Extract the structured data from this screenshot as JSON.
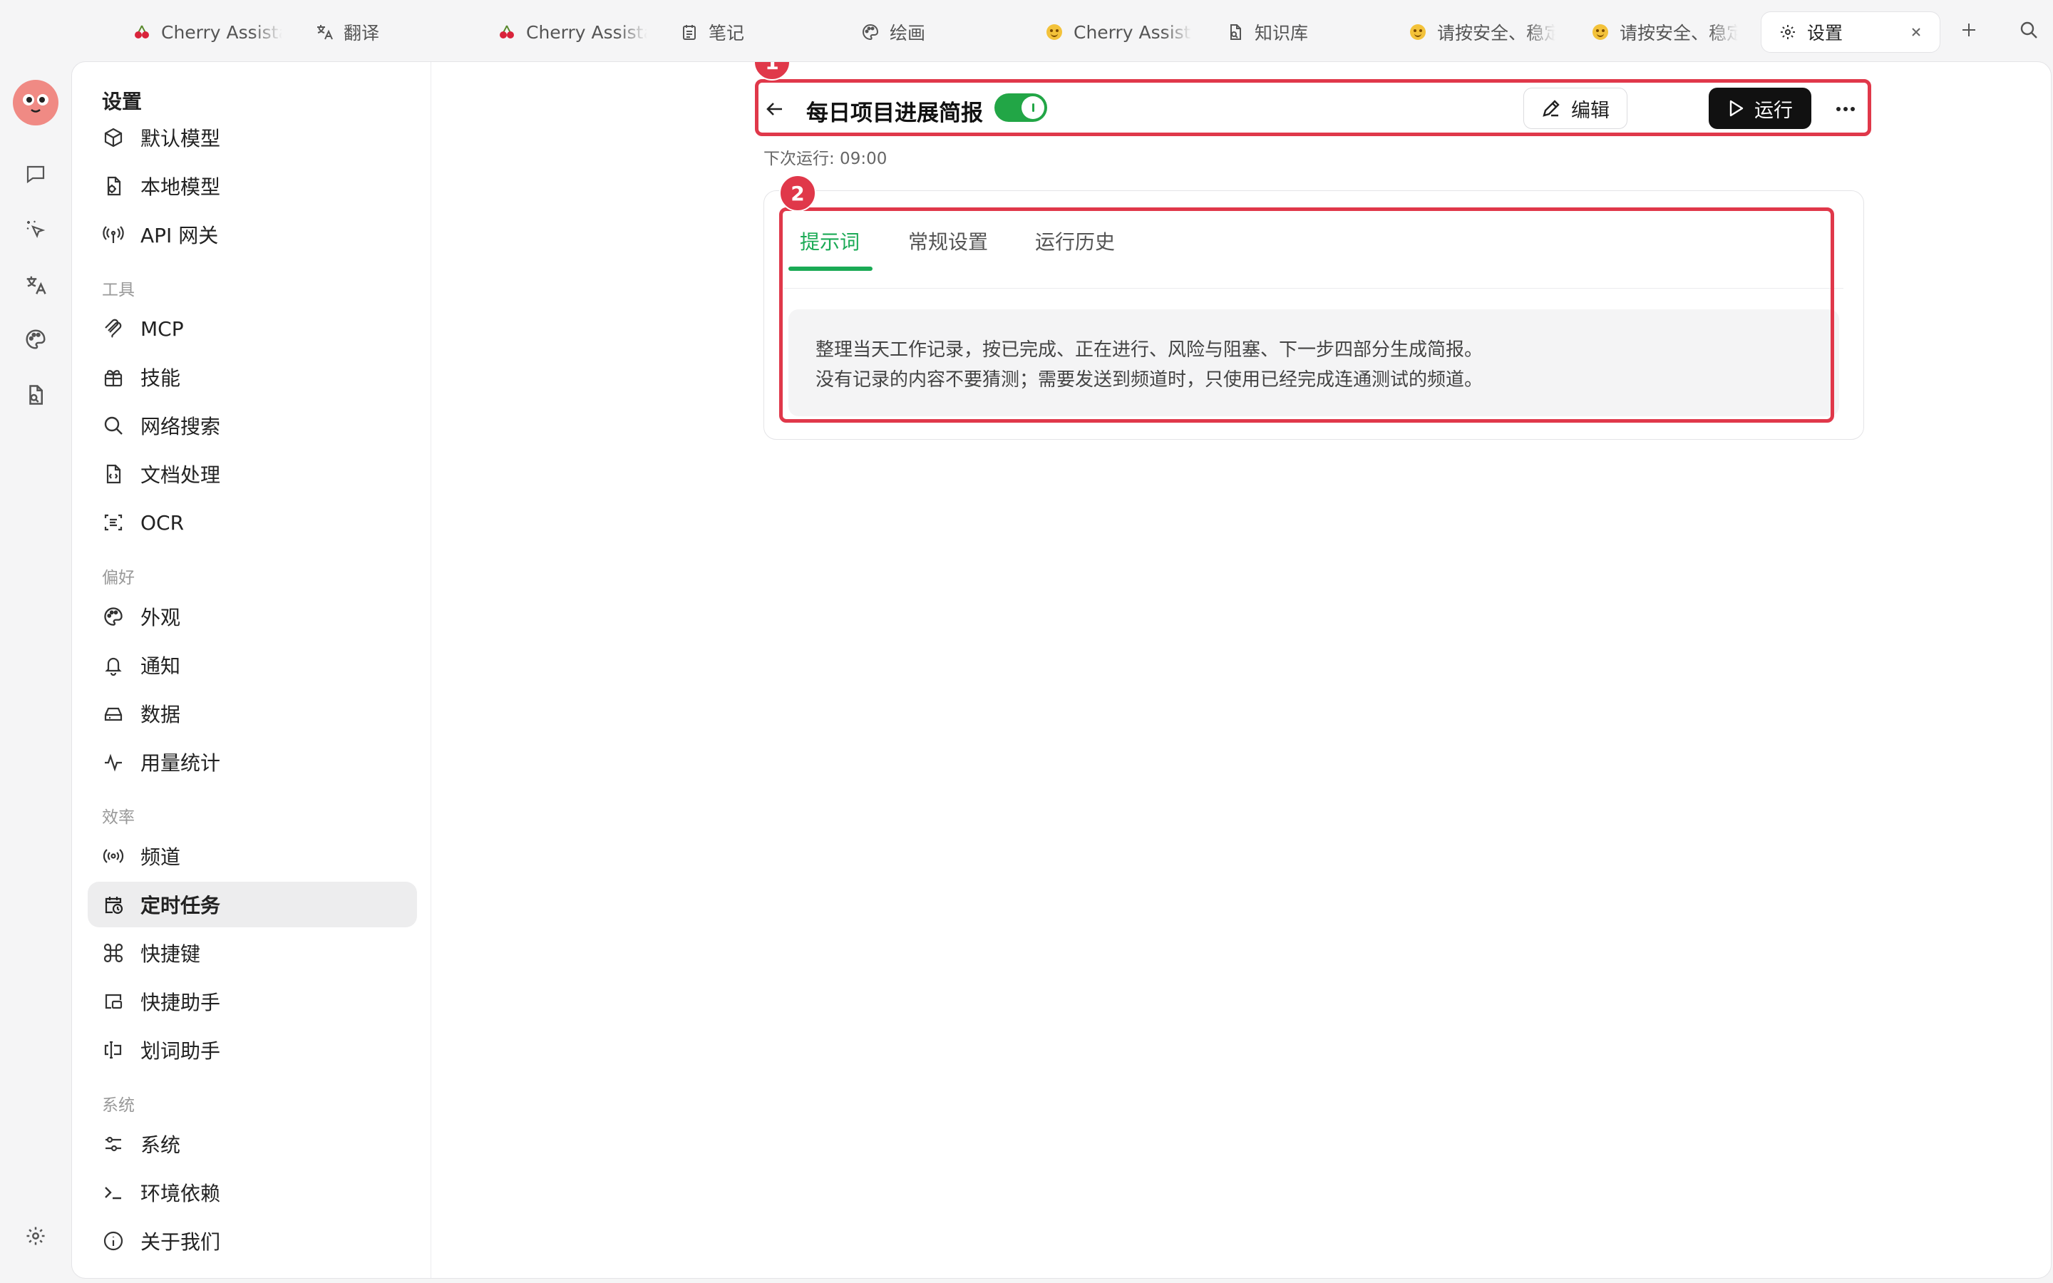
{
  "tabbar": {
    "tabs": [
      {
        "icon": "cherry-icon",
        "label": "Cherry Assistant"
      },
      {
        "icon": "translate-icon",
        "label": "翻译"
      },
      {
        "icon": "cherry-icon",
        "label": "Cherry Assistant"
      },
      {
        "icon": "notes-icon",
        "label": "笔记"
      },
      {
        "icon": "palette-icon",
        "label": "绘画"
      },
      {
        "icon": "smiley-icon",
        "label": "Cherry Assistant"
      },
      {
        "icon": "knowledge-icon",
        "label": "知识库"
      },
      {
        "icon": "smiley-icon",
        "label": "请按安全、稳定"
      },
      {
        "icon": "smiley-icon",
        "label": "请按安全、稳定"
      },
      {
        "icon": "gear-icon",
        "label": "设置"
      }
    ],
    "active_tab": "设置"
  },
  "settings_nav": {
    "title": "设置",
    "top_items": [
      {
        "icon": "cube-icon",
        "label": "默认模型"
      },
      {
        "icon": "local-model-icon",
        "label": "本地模型"
      },
      {
        "icon": "antenna-icon",
        "label": "API 网关"
      }
    ],
    "sections": [
      {
        "title": "工具",
        "items": [
          {
            "icon": "mcp-icon",
            "label": "MCP"
          },
          {
            "icon": "skill-icon",
            "label": "技能"
          },
          {
            "icon": "search-icon",
            "label": "网络搜索"
          },
          {
            "icon": "document-icon",
            "label": "文档处理"
          },
          {
            "icon": "ocr-icon",
            "label": "OCR"
          }
        ]
      },
      {
        "title": "偏好",
        "items": [
          {
            "icon": "palette-icon",
            "label": "外观"
          },
          {
            "icon": "bell-icon",
            "label": "通知"
          },
          {
            "icon": "drive-icon",
            "label": "数据"
          },
          {
            "icon": "activity-icon",
            "label": "用量统计"
          }
        ]
      },
      {
        "title": "效率",
        "items": [
          {
            "icon": "broadcast-icon",
            "label": "频道"
          },
          {
            "icon": "calendar-clock-icon",
            "label": "定时任务"
          },
          {
            "icon": "command-icon",
            "label": "快捷键"
          },
          {
            "icon": "quick-assistant-icon",
            "label": "快捷助手"
          },
          {
            "icon": "text-select-icon",
            "label": "划词助手"
          }
        ]
      },
      {
        "title": "系统",
        "items": [
          {
            "icon": "sliders-icon",
            "label": "系统"
          },
          {
            "icon": "terminal-icon",
            "label": "环境依赖"
          },
          {
            "icon": "info-icon",
            "label": "关于我们"
          }
        ]
      }
    ],
    "active_item": "定时任务"
  },
  "task": {
    "title": "每日项目进展简报",
    "enabled": true,
    "edit_label": "编辑",
    "run_label": "运行",
    "next_run": "下次运行: 09:00"
  },
  "annotations": {
    "badge1": "1",
    "badge2": "2",
    "color": "#e0384a"
  },
  "detail_tabs": [
    "提示词",
    "常规设置",
    "运行历史"
  ],
  "active_detail_tab": "提示词",
  "prompt": {
    "line1": "整理当天工作记录，按已完成、正在进行、风险与阻塞、下一步四部分生成简报。",
    "line2": "没有记录的内容不要猜测；需要发送到频道时，只使用已经完成连通测试的频道。"
  },
  "colors": {
    "accent_green": "#1aaa55",
    "toggle_green": "#22a646",
    "run_button": "#111111"
  }
}
